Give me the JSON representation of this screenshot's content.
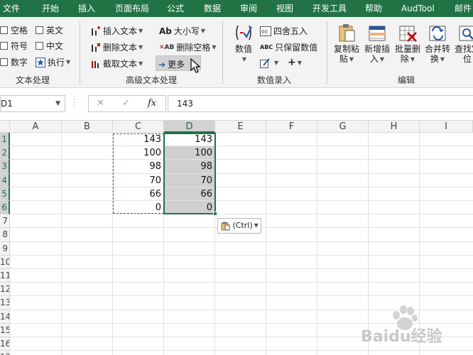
{
  "tabs": [
    "文件",
    "开始",
    "插入",
    "页面布局",
    "公式",
    "数据",
    "审阅",
    "视图",
    "开发工具",
    "帮助",
    "AudTool",
    "邮件"
  ],
  "ribbon": {
    "wenben": {
      "checkboxes": [
        "空格",
        "英文",
        "符号",
        "中文",
        "数字"
      ],
      "exec_label": "执行",
      "group_label": "文本处理"
    },
    "gaoji": {
      "insert_text": "插入文本",
      "delete_text": "删除文本",
      "extract_text": "截取文本",
      "case_label": "大小写",
      "case_icon_text": "Ab",
      "delete_space": "删除空格",
      "delete_space_icon_text": "AB",
      "more": "更多",
      "group_label": "高级文本处理"
    },
    "shuzhi": {
      "value_label": "数值",
      "round_label": "四舍五入",
      "keep_label": "只保留数值",
      "keep_icon_text": "ABC",
      "group_label": "数值录入"
    },
    "bianji": {
      "buttons": [
        {
          "line1": "复制粘",
          "line2": "贴"
        },
        {
          "line1": "新增插",
          "line2": "入"
        },
        {
          "line1": "批量删",
          "line2": "除"
        },
        {
          "line1": "合并转",
          "line2": "换"
        },
        {
          "line1": "查找定",
          "line2": "位"
        }
      ],
      "group_label": "编辑"
    }
  },
  "formula_bar": {
    "name_box": "D1",
    "cancel_glyph": "✕",
    "enter_glyph": "✓",
    "fx_label": "fx",
    "formula": "143"
  },
  "grid": {
    "columns": [
      "A",
      "B",
      "C",
      "D",
      "E",
      "F",
      "G",
      "H",
      "I"
    ],
    "rows": [
      "1",
      "2",
      "3",
      "4",
      "5",
      "6",
      "7",
      "8",
      "9",
      "10",
      "11",
      "12",
      "13",
      "14",
      "15",
      "16",
      "17"
    ],
    "col_c": [
      "143",
      "100",
      "98",
      "70",
      "66",
      "0"
    ],
    "col_d": [
      "143",
      "100",
      "98",
      "70",
      "66",
      "0"
    ],
    "selected_column": "D"
  },
  "paste_options": {
    "label": "(Ctrl)"
  },
  "watermark": {
    "text": "Baidu经验"
  },
  "colors": {
    "excel_green": "#217346",
    "selection_fill": "#d0d0d0"
  }
}
